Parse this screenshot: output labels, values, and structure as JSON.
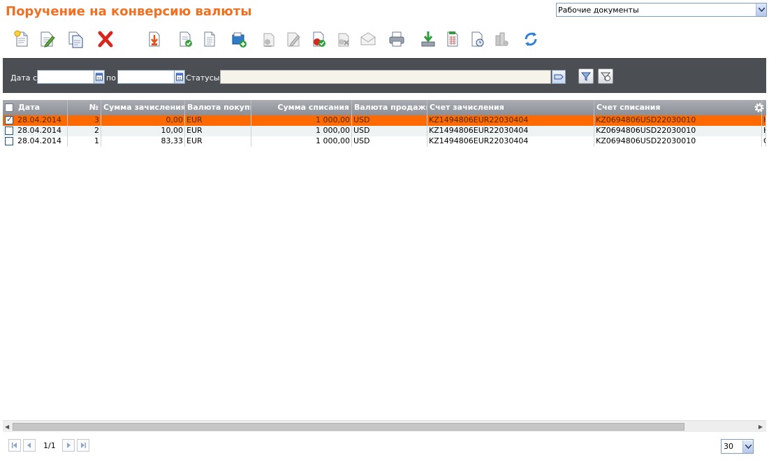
{
  "page": {
    "title": "Поручение на конверсию валюты"
  },
  "view_selector": {
    "value": "Рабочие документы"
  },
  "toolbar": {
    "buttons": [
      "new-document-icon",
      "edit-document-icon",
      "copy-document-icon",
      "delete-icon",
      "import-icon",
      "sign-document-icon",
      "view-document-icon",
      "add-to-package-icon",
      "check-document-icon",
      "sign-pen-icon",
      "send-document-icon",
      "cancel-sign-icon",
      "envelope-icon",
      "print-icon",
      "export-icon",
      "excel-report-icon",
      "document-history-icon",
      "request-status-icon",
      "refresh-icon"
    ]
  },
  "filters": {
    "date_from_label": "Дата с",
    "date_from_value": "",
    "date_to_label": "по",
    "date_to_value": "",
    "calendar_icon_text": "31",
    "status_label": "Статусы",
    "status_value": ""
  },
  "table": {
    "columns": [
      "Дата",
      "№",
      "Сумма зачисления",
      "Валюта покупк",
      "Сумма списания",
      "Валюта продажи",
      "Счет зачисления",
      "Счет списания"
    ],
    "rows": [
      {
        "selected": true,
        "date": "28.04.2014",
        "num": "3",
        "credit_amount": "0,00",
        "buy_currency": "EUR",
        "debit_amount": "1 000,00",
        "sell_currency": "USD",
        "credit_account": "KZ1494806EUR22030404",
        "debit_account": "KZ0694806USD22030010",
        "extra": "Н"
      },
      {
        "selected": false,
        "date": "28.04.2014",
        "num": "2",
        "credit_amount": "10,00",
        "buy_currency": "EUR",
        "debit_amount": "1 000,00",
        "sell_currency": "USD",
        "credit_account": "KZ1494806EUR22030404",
        "debit_account": "KZ0694806USD22030010",
        "extra": "Н"
      },
      {
        "selected": false,
        "date": "28.04.2014",
        "num": "1",
        "credit_amount": "83,33",
        "buy_currency": "EUR",
        "debit_amount": "1 000,00",
        "sell_currency": "USD",
        "credit_account": "KZ1494806EUR22030404",
        "debit_account": "KZ0694806USD22030010",
        "extra": "О"
      }
    ]
  },
  "pager": {
    "info": "1/1",
    "page_size": "30"
  },
  "colors": {
    "accent": "#f26f21",
    "selected_row": "#ff6a00",
    "filter_bar": "#4b4f54",
    "header": "#9a9ea4"
  }
}
